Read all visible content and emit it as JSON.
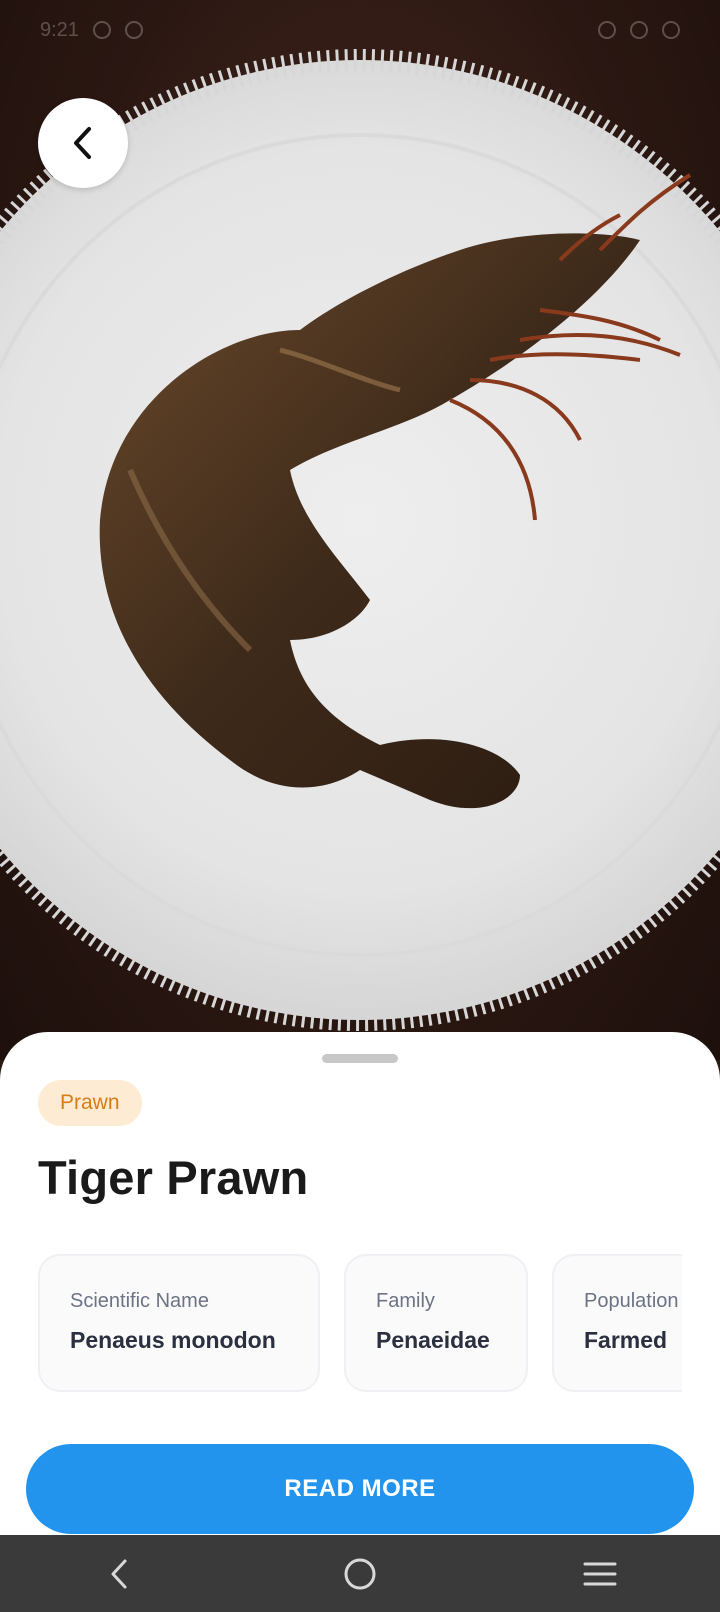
{
  "status_bar": {
    "time": "9:21"
  },
  "header": {
    "back_icon": "chevron-left-icon"
  },
  "sheet": {
    "tag": {
      "label": "Prawn",
      "bg_color": "#fdebd3",
      "text_color": "#d97c16"
    },
    "title": "Tiger Prawn",
    "info_cards": [
      {
        "label": "Scientific Name",
        "value": "Penaeus monodon"
      },
      {
        "label": "Family",
        "value": "Penaeidae"
      },
      {
        "label": "Population",
        "value": "Farmed"
      }
    ],
    "read_more_label": "READ MORE",
    "accent_color": "#2294ee"
  },
  "nav_bar": {
    "icons": [
      "back-icon",
      "home-icon",
      "recent-apps-icon"
    ]
  }
}
